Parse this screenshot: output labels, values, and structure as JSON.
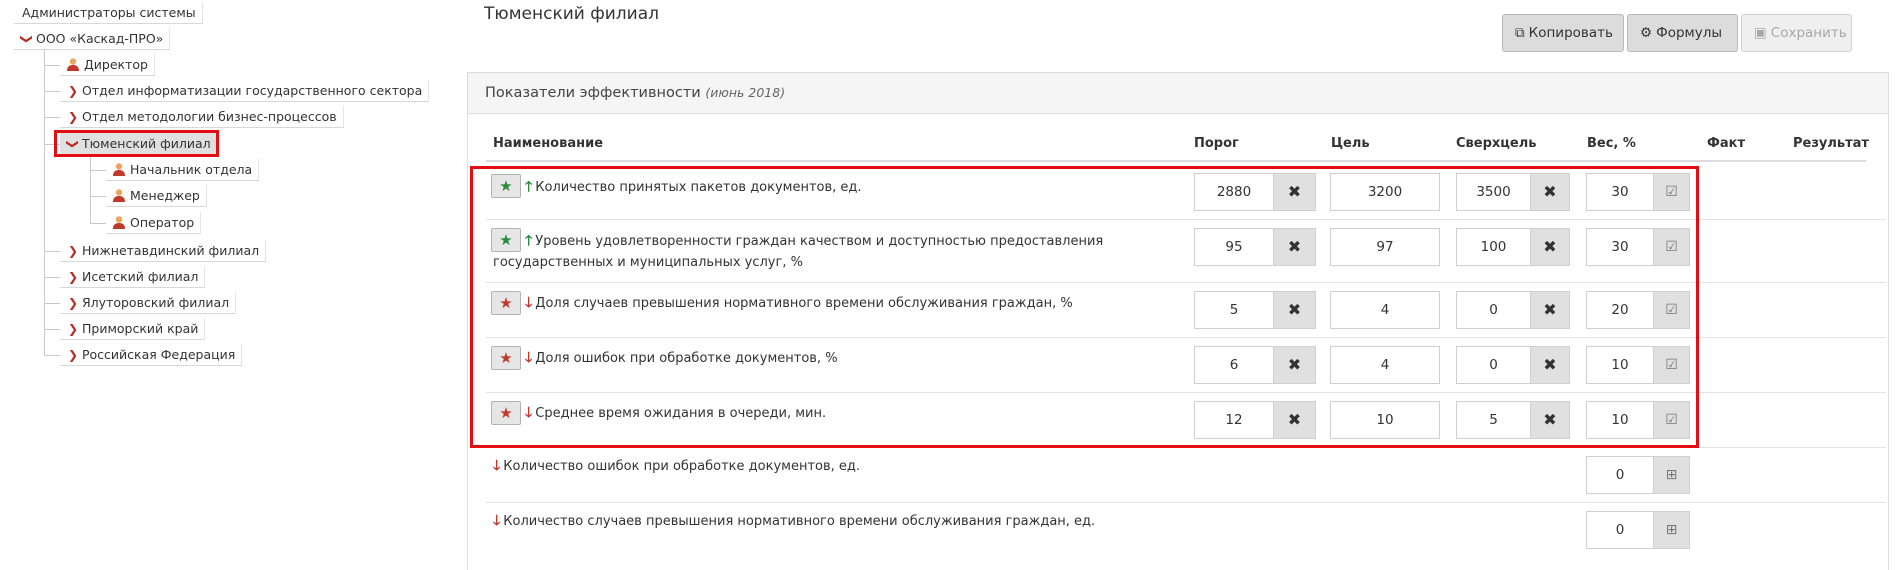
{
  "tree": {
    "root": "Администраторы системы",
    "org": "ООО «Каскад-ПРО»",
    "director": "Директор",
    "dept1": "Отдел информатизации государственного сектора",
    "dept2": "Отдел методологии бизнес-процессов",
    "selected": "Тюменский филиал",
    "child1": "Начальник отдела",
    "child2": "Менеджер",
    "child3": "Оператор",
    "b1": "Нижнетавдинский филиал",
    "b2": "Исетский филиал",
    "b3": "Ялуторовский филиал",
    "b4": "Приморский край",
    "b5": "Российская Федерация"
  },
  "page_title": "Тюменский филиал",
  "toolbar": {
    "copy": "Копировать",
    "formulas": "Формулы",
    "save": "Сохранить"
  },
  "panel": {
    "title": "Показатели эффективности",
    "period": "(июнь 2018)"
  },
  "columns": {
    "name": "Наименование",
    "threshold": "Порог",
    "goal": "Цель",
    "supergoal": "Сверхцель",
    "weight": "Вес, %",
    "fact": "Факт",
    "result": "Результат"
  },
  "indicators": [
    {
      "name": "Количество принятых пакетов документов, ед.",
      "star": "green",
      "trend": "up",
      "threshold": "2880",
      "goal": "3200",
      "supergoal": "3500",
      "weight": "30"
    },
    {
      "name": "Уровень удовлетворенности граждан качеством и доступностью предоставления",
      "name2": "государственных и муниципальных услуг, %",
      "star": "green",
      "trend": "up",
      "threshold": "95",
      "goal": "97",
      "supergoal": "100",
      "weight": "30"
    },
    {
      "name": "Доля случаев превышения нормативного времени обслуживания граждан, %",
      "star": "red",
      "trend": "down",
      "threshold": "5",
      "goal": "4",
      "supergoal": "0",
      "weight": "20"
    },
    {
      "name": "Доля ошибок при обработке документов, %",
      "star": "red",
      "trend": "down",
      "threshold": "6",
      "goal": "4",
      "supergoal": "0",
      "weight": "10"
    },
    {
      "name": "Среднее время ожидания в очереди, мин.",
      "star": "red",
      "trend": "down",
      "threshold": "12",
      "goal": "10",
      "supergoal": "5",
      "weight": "10"
    }
  ],
  "extra": [
    {
      "name": "Количество ошибок при обработке документов, ед.",
      "trend": "down",
      "weight": "0"
    },
    {
      "name": "Количество случаев превышения нормативного времени обслуживания граждан, ед.",
      "trend": "down",
      "weight": "0"
    }
  ],
  "icons": {
    "star": "star-icon",
    "close": "times-icon",
    "edit": "edit-icon",
    "add": "plus-square-icon",
    "copy": "copy-icon",
    "formulas": "cogs-icon",
    "save": "floppy-icon",
    "chevron": "chevron-icon",
    "person": "user-icon"
  },
  "colors": {
    "highlight": "#e10f14",
    "green": "#2c8a3c",
    "red": "#c0392b"
  }
}
